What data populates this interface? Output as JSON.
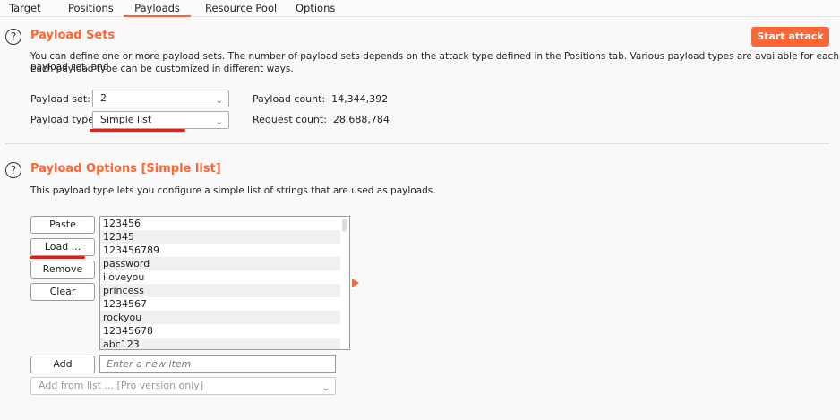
{
  "tabs": [
    "Target",
    "Positions",
    "Payloads",
    "Resource Pool",
    "Options"
  ],
  "active_tab": "Payloads",
  "accent_color": "#ff6633",
  "payload_sets": {
    "title": "Payload Sets",
    "start_attack": "Start attack",
    "desc1": "You can define one or more payload sets. The number of payload sets depends on the attack type defined in the Positions tab. Various payload types are available for each payload set, and",
    "desc2": "each payload type can be customized in different ways.",
    "set_label": "Payload set:",
    "set_value": "2",
    "type_label": "Payload type:",
    "type_value": "Simple list",
    "payload_count_label": "Payload count:",
    "payload_count": "14,344,392",
    "request_count_label": "Request count:",
    "request_count": "28,688,784"
  },
  "payload_options": {
    "title": "Payload Options [Simple list]",
    "desc": "This payload type lets you configure a simple list of strings that are used as payloads.",
    "buttons": {
      "paste": "Paste",
      "load": "Load ...",
      "remove": "Remove",
      "clear": "Clear",
      "add": "Add"
    },
    "items": [
      "123456",
      "12345",
      "123456789",
      "password",
      "iloveyou",
      "princess",
      "1234567",
      "rockyou",
      "12345678",
      "abc123"
    ],
    "new_item_placeholder": "Enter a new item",
    "add_from_list": "Add from list ... [Pro version only]"
  }
}
